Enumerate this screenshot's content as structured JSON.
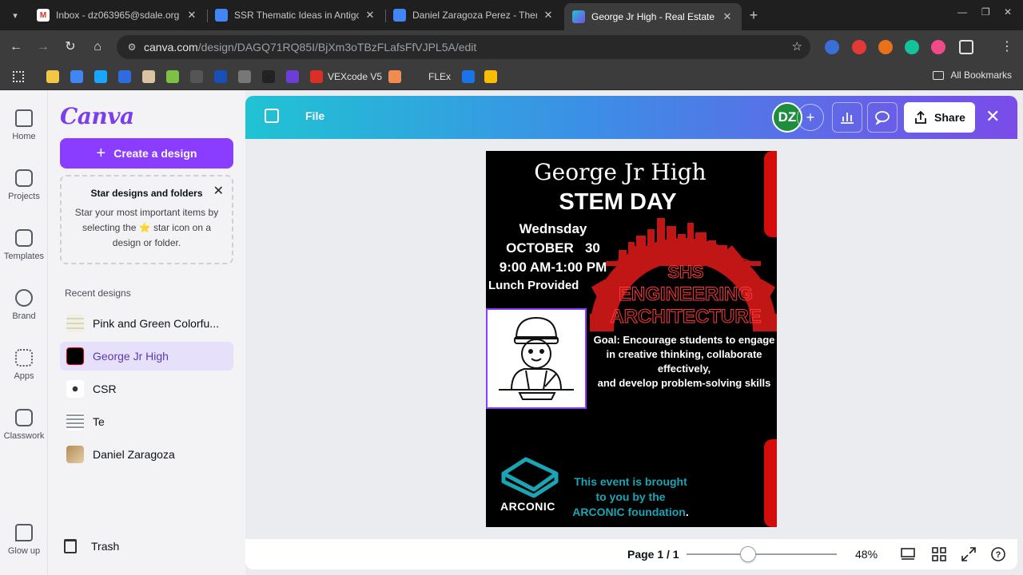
{
  "browser": {
    "tabs": [
      {
        "title": "Inbox - dz063965@sdale.org -",
        "icon": "gmail-icon",
        "active": false
      },
      {
        "title": "SSR Thematic Ideas in Antigon",
        "icon": "docs-icon",
        "active": false
      },
      {
        "title": "Daniel Zaragoza Perez - Thema",
        "icon": "docs-icon",
        "active": false
      },
      {
        "title": "George Jr High - Real Estate Fl",
        "icon": "canva-icon",
        "active": true
      }
    ],
    "url_host": "canva.com",
    "url_path": "/design/DAGQ71RQ85I/BjXm3oTBzFLafsFfVJPL5A/edit",
    "bookmarks": [
      {
        "label": "",
        "color": "#f2c744"
      },
      {
        "label": "",
        "color": "#4285f4"
      },
      {
        "label": "",
        "color": "#1aa5ff"
      },
      {
        "label": "",
        "color": "#2d6cdf"
      },
      {
        "label": "",
        "color": "#d9c3a0"
      },
      {
        "label": "",
        "color": "#7cc142"
      },
      {
        "label": "",
        "color": "#555"
      },
      {
        "label": "",
        "color": "#1a4fb5"
      },
      {
        "label": "",
        "color": "#777"
      },
      {
        "label": "",
        "color": "#222"
      },
      {
        "label": "",
        "color": "#6a3fd6"
      },
      {
        "label": "VEXcode V5",
        "color": "#d93025"
      },
      {
        "label": "",
        "color": "#f28b52"
      },
      {
        "label": "FLEx",
        "color": "#3c3c3c"
      },
      {
        "label": "",
        "color": "#1a73e8"
      },
      {
        "label": "",
        "color": "#fbbc04"
      }
    ],
    "all_bookmarks": "All Bookmarks"
  },
  "rail": [
    {
      "label": "Home",
      "icon": "home-icon"
    },
    {
      "label": "Projects",
      "icon": "folder-icon"
    },
    {
      "label": "Templates",
      "icon": "templates-icon"
    },
    {
      "label": "Brand",
      "icon": "brand-icon"
    },
    {
      "label": "Apps",
      "icon": "apps-icon"
    },
    {
      "label": "Classwork",
      "icon": "classwork-icon"
    },
    {
      "label": "Glow up",
      "icon": "glow-up-icon"
    }
  ],
  "panel": {
    "logo": "Canva",
    "create_label": "Create a design",
    "tip_title": "Star designs and folders",
    "tip_body": "Star your most important items by selecting the ⭐ star icon on a design or folder.",
    "recent_heading": "Recent designs",
    "recent": [
      {
        "label": "Pink and Green Colorfu...",
        "selected": false
      },
      {
        "label": "George Jr High",
        "selected": true
      },
      {
        "label": "CSR",
        "selected": false
      },
      {
        "label": "Te",
        "selected": false
      },
      {
        "label": "Daniel Zaragoza",
        "selected": false
      }
    ],
    "trash_label": "Trash"
  },
  "editor": {
    "file_label": "File",
    "avatar_initials": "DZ",
    "share_label": "Share",
    "page_label": "Page 1 / 1",
    "zoom_label": "48%",
    "zoom_fraction": 0.4
  },
  "poster": {
    "title": "George Jr High",
    "subtitle": "STEM DAY",
    "day": "Wednsday",
    "date": "OCTOBER   30",
    "time": "9:00 AM-1:00 PM",
    "lunch": "Lunch Provided",
    "logo_line1": "SHS",
    "logo_line2": "ENGINEERING",
    "logo_line3": "ARCHITECTURE",
    "goal": "Goal: Encourage students to engage in creative thinking, collaborate effectively,\nand develop problem-solving skills",
    "sponsor_logo": "ARCONIC",
    "credit_line1": "This event is brought",
    "credit_line2": "to you by the",
    "credit_line3": "ARCONIC foundation",
    "credit_period": ".",
    "colors": {
      "red": "#d40c0c",
      "teal": "#1aa5b4",
      "background": "#000000"
    }
  }
}
